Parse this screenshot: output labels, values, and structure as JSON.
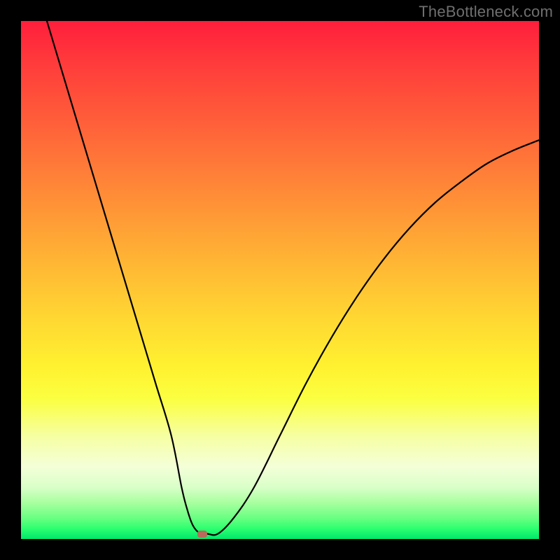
{
  "watermark": {
    "text": "TheBottleneck.com"
  },
  "colors": {
    "frame": "#000000",
    "curve": "#000000",
    "marker": "#b96a5a",
    "watermark_text": "#6f6f6f",
    "gradient_top": "#ff1e3c",
    "gradient_bottom": "#00e86a"
  },
  "chart_data": {
    "type": "line",
    "title": "",
    "xlabel": "",
    "ylabel": "",
    "xlim": [
      0,
      100
    ],
    "ylim": [
      0,
      100
    ],
    "grid": false,
    "legend": false,
    "series": [
      {
        "name": "bottleneck-curve",
        "x": [
          5,
          8,
          11,
          14,
          17,
          20,
          23,
          26,
          29,
          31,
          32,
          33,
          34,
          35,
          36,
          38,
          41,
          45,
          50,
          55,
          60,
          65,
          70,
          75,
          80,
          85,
          90,
          95,
          100
        ],
        "y": [
          100,
          90,
          80,
          70,
          60,
          50,
          40,
          30,
          20,
          10,
          6,
          3,
          1.5,
          1,
          1,
          1,
          4,
          10,
          20,
          30,
          39,
          47,
          54,
          60,
          65,
          69,
          72.5,
          75,
          77
        ]
      }
    ],
    "annotations": [
      {
        "name": "optimal-marker",
        "type": "point",
        "x": 35,
        "y": 1
      }
    ],
    "background": {
      "type": "vertical-gradient",
      "stops": [
        {
          "pos": 0.0,
          "color": "#ff1e3c"
        },
        {
          "pos": 0.5,
          "color": "#ffd932"
        },
        {
          "pos": 0.75,
          "color": "#fbff41"
        },
        {
          "pos": 1.0,
          "color": "#00e86a"
        }
      ]
    }
  }
}
